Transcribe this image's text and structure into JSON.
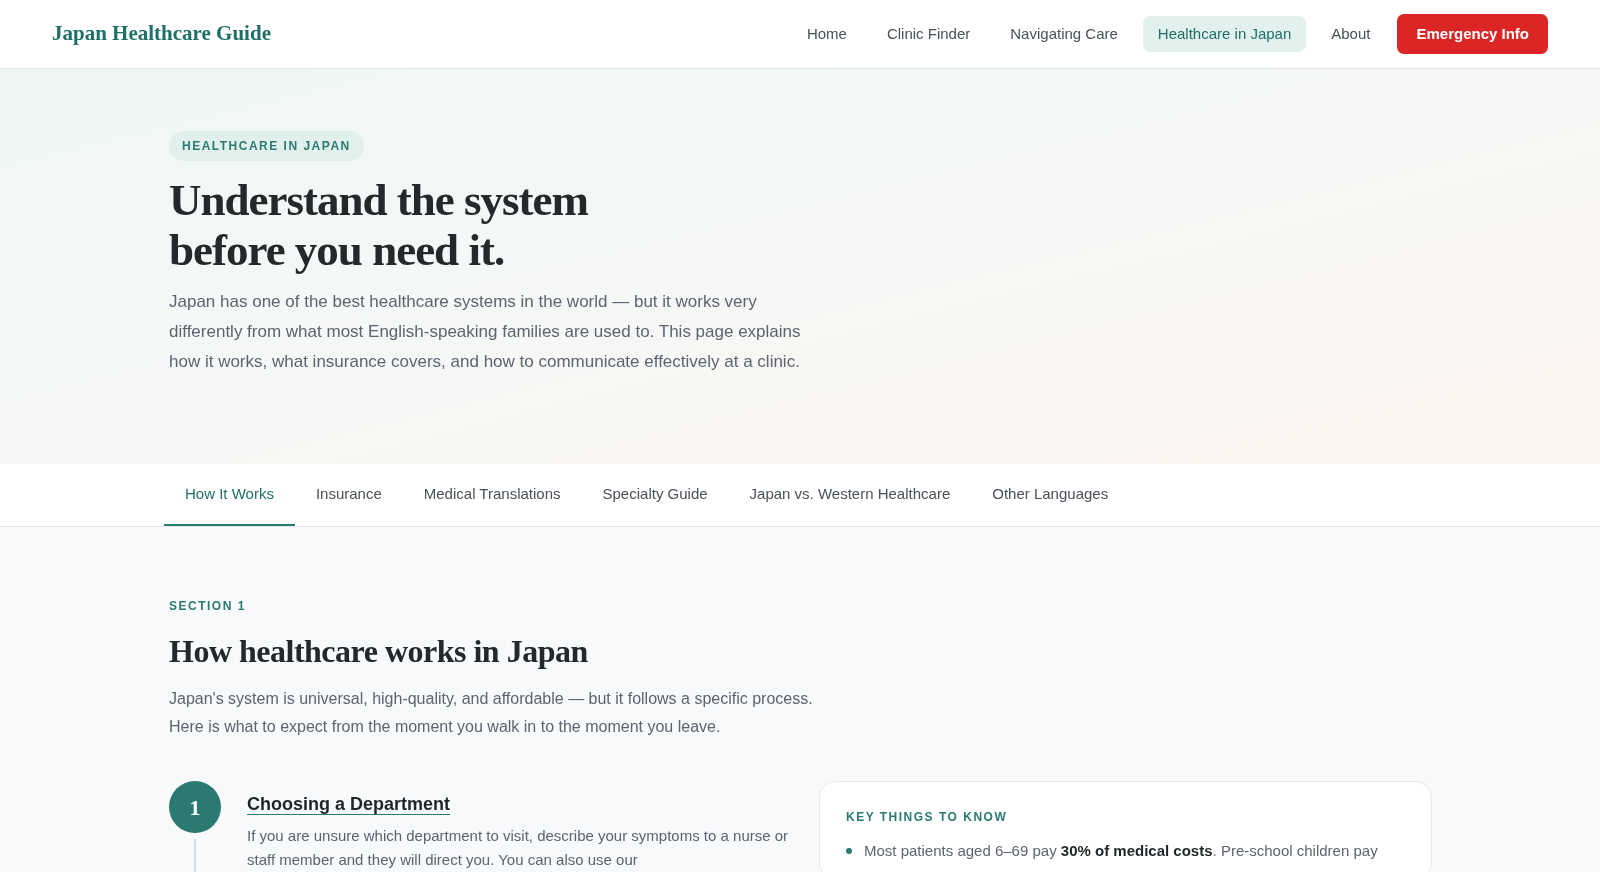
{
  "site_title": "Japan Healthcare Guide",
  "nav": [
    {
      "label": "Home",
      "selected": false
    },
    {
      "label": "Clinic Finder",
      "selected": false
    },
    {
      "label": "Navigating Care",
      "selected": false
    },
    {
      "label": "Healthcare in Japan",
      "selected": true
    },
    {
      "label": "About",
      "selected": false
    }
  ],
  "emergency_button": "Emergency Info",
  "hero": {
    "badge": "HEALTHCARE IN JAPAN",
    "title_lines": [
      "Understand the system",
      "before you need it."
    ],
    "intro": "Japan has one of the best healthcare systems in the world — but it works very differently from what most English-speaking families are used to. This page explains how it works, what insurance covers, and how to communicate effectively at a clinic."
  },
  "tabs": [
    {
      "label": "How It Works",
      "selected": true
    },
    {
      "label": "Insurance",
      "selected": false
    },
    {
      "label": "Medical Translations",
      "selected": false
    },
    {
      "label": "Specialty Guide",
      "selected": false
    },
    {
      "label": "Japan vs. Western Healthcare",
      "selected": false
    },
    {
      "label": "Other Languages",
      "selected": false
    }
  ],
  "section": {
    "eyebrow": "SECTION 1",
    "title": "How healthcare works in Japan",
    "intro": "Japan's system is universal, high-quality, and affordable — but it follows a specific process. Here is what to expect from the moment you walk in to the moment you leave.",
    "steps": [
      {
        "number": "1",
        "title": "Choosing a Department",
        "text": "If you are unsure which department to visit, describe your symptoms to a nurse or staff member and they will direct you. You can also use our"
      }
    ],
    "key_card": {
      "title": "KEY THINGS TO KNOW",
      "items": [
        "Most patients aged 6–69 pay **30% of medical costs**. Pre-school children pay"
      ]
    }
  }
}
